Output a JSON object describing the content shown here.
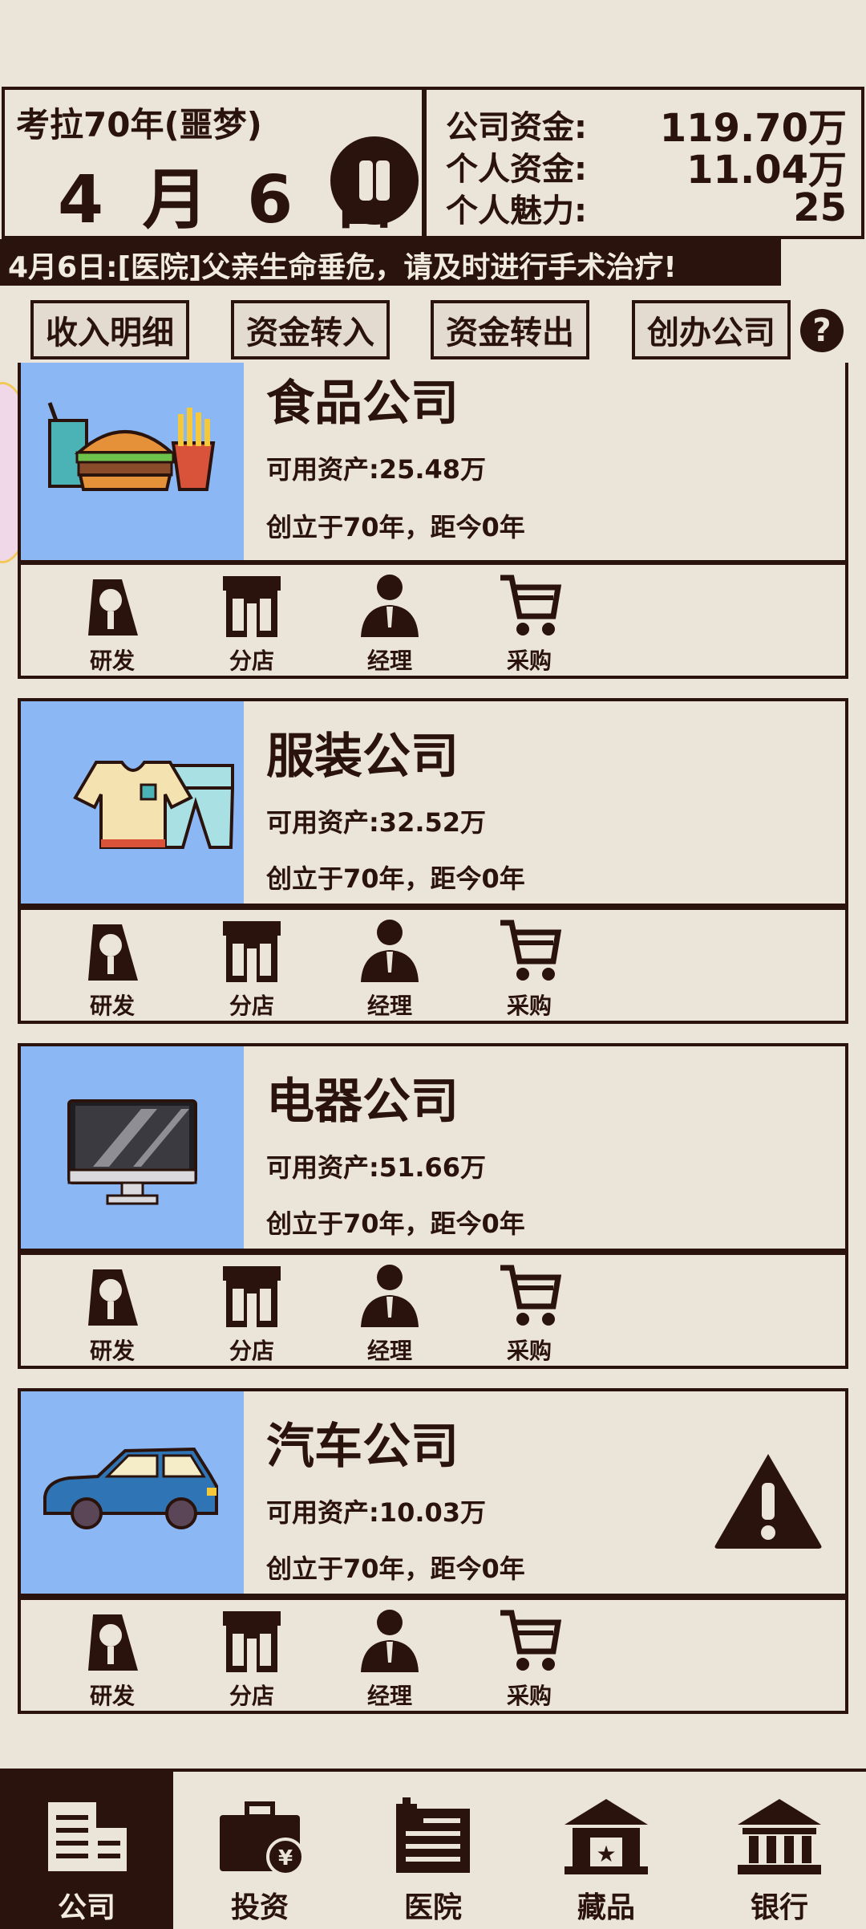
{
  "header": {
    "game_title": "考拉70年(噩梦)",
    "date": "4 月 6 日",
    "funds": [
      {
        "label": "公司资金:",
        "value": "119.70万"
      },
      {
        "label": "个人资金:",
        "value": "11.04万"
      },
      {
        "label": "个人魅力:",
        "value": "25"
      }
    ]
  },
  "news": "4月6日:[医院]父亲生命垂危，请及时进行手术治疗!",
  "actions": [
    "收入明细",
    "资金转入",
    "资金转出",
    "创办公司"
  ],
  "help_label": "?",
  "companies": [
    {
      "name": "食品公司",
      "assets": "可用资产:25.48万",
      "founded": "创立于70年，距今0年",
      "icon": "burger-fries-icon",
      "warning": false
    },
    {
      "name": "服装公司",
      "assets": "可用资产:32.52万",
      "founded": "创立于70年，距今0年",
      "icon": "clothes-icon",
      "warning": false
    },
    {
      "name": "电器公司",
      "assets": "可用资产:51.66万",
      "founded": "创立于70年，距今0年",
      "icon": "monitor-icon",
      "warning": false
    },
    {
      "name": "汽车公司",
      "assets": "可用资产:10.03万",
      "founded": "创立于70年，距今0年",
      "icon": "car-icon",
      "warning": true
    }
  ],
  "company_ops": [
    "研发",
    "分店",
    "经理",
    "采购"
  ],
  "bottom_nav": [
    {
      "label": "公司",
      "icon": "company-icon",
      "active": true
    },
    {
      "label": "投资",
      "icon": "briefcase-icon",
      "active": false
    },
    {
      "label": "医院",
      "icon": "hospital-icon",
      "active": false
    },
    {
      "label": "藏品",
      "icon": "museum-icon",
      "active": false
    },
    {
      "label": "银行",
      "icon": "bank-icon",
      "active": false
    }
  ],
  "colors": {
    "background": "#ebe4d8",
    "dark": "#2a130c",
    "card_image_bg": "#8bb8f5"
  }
}
